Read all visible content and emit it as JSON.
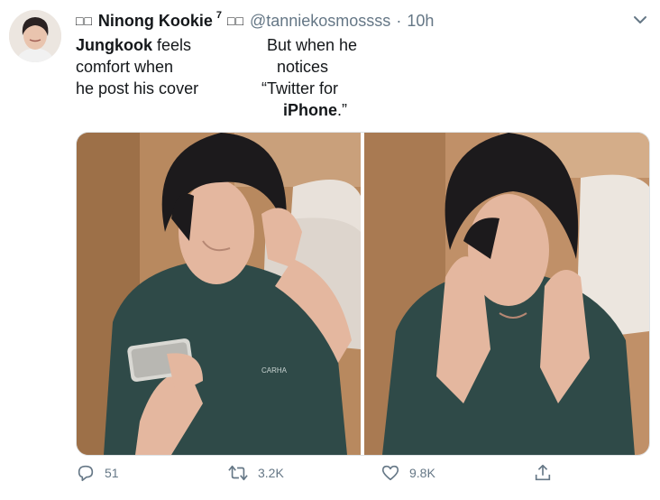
{
  "tweet": {
    "name_prefix_glyph": "□□",
    "name": "Ninong Kookie",
    "name_superscript": "7",
    "name_suffix_glyph": "□□",
    "handle": "@tanniekosmossss",
    "separator": "·",
    "time": "10h",
    "left_text": {
      "line1_bold": "Jungkook",
      "line1_rest": " feels",
      "line2": "comfort when",
      "line3": "he post his cover"
    },
    "right_text": {
      "line1": "But when he",
      "line2": "notices",
      "line3": "“Twitter for",
      "line4_bold": "iPhone",
      "line4_rest": ".”"
    }
  },
  "actions": {
    "replies": "51",
    "retweets": "3.2K",
    "likes": "9.8K"
  },
  "colors": {
    "text": "#14171a",
    "secondary": "#657786",
    "shirt": "#2f4a48",
    "hair": "#1c1a1c",
    "skin": "#e4b79f",
    "wall": "#b8895f"
  },
  "icons": [
    "chevron-down-icon",
    "reply-icon",
    "retweet-icon",
    "like-icon",
    "share-icon"
  ]
}
